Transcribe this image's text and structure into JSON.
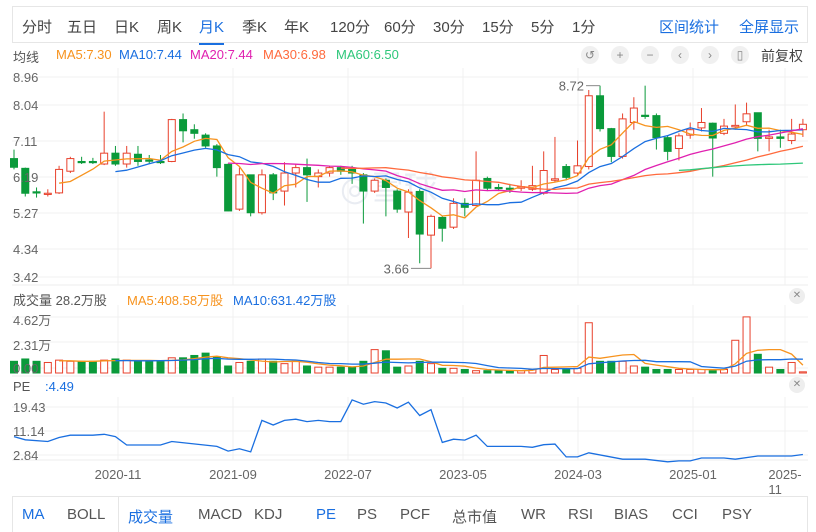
{
  "tabs": [
    {
      "label": "分时"
    },
    {
      "label": "五日"
    },
    {
      "label": "日K"
    },
    {
      "label": "周K"
    },
    {
      "label": "月K",
      "active": true
    },
    {
      "label": "季K"
    },
    {
      "label": "年K"
    },
    {
      "label": "120分"
    },
    {
      "label": "60分"
    },
    {
      "label": "30分"
    },
    {
      "label": "15分"
    },
    {
      "label": "5分"
    },
    {
      "label": "1分"
    }
  ],
  "right_links": {
    "range_stats": "区间统计",
    "fullscreen": "全屏显示"
  },
  "ma_legend": {
    "title": "均线",
    "ma5": "MA5:7.30",
    "ma10": "MA10:7.44",
    "ma20": "MA20:7.44",
    "ma30": "MA30:6.98",
    "ma60": "MA60:6.50"
  },
  "toolbar": {
    "icons": [
      "undo-icon",
      "zoom-in-icon",
      "zoom-out-icon",
      "scroll-left-icon",
      "scroll-right-icon",
      "candle-style-icon"
    ],
    "adjust": "前复权"
  },
  "colors": {
    "up": "#e8412c",
    "down": "#0a9a3a",
    "ma5": "#f7931e",
    "ma10": "#1a6fe0",
    "ma20": "#e020b0",
    "ma30": "#ff6a3d",
    "ma60": "#2ec77a",
    "accent": "#1a6fe0"
  },
  "price_axis": [
    "8.96",
    "8.04",
    "7.11",
    "6.19",
    "5.27",
    "4.34",
    "3.42"
  ],
  "annotations": {
    "high": "8.72",
    "low": "3.66"
  },
  "volume": {
    "title": "成交量 28.2万股",
    "ma5": "MA5:408.58万股",
    "ma10": "MA10:631.42万股",
    "axis": [
      "4.62万",
      "2.31万",
      "0.00"
    ]
  },
  "pe": {
    "title": "PE",
    "value": ":4.49",
    "axis": [
      "19.43",
      "11.14",
      "2.84"
    ]
  },
  "x_axis": [
    "2020-11",
    "2021-09",
    "2022-07",
    "2023-05",
    "2024-03",
    "2025-01",
    "2025-11"
  ],
  "indicators": [
    {
      "label": "MA",
      "on": true
    },
    {
      "label": "BOLL"
    },
    {
      "label": "成交量",
      "on": true
    },
    {
      "label": "MACD"
    },
    {
      "label": "KDJ"
    },
    {
      "label": "PE",
      "on": true
    },
    {
      "label": "PS"
    },
    {
      "label": "PCF"
    },
    {
      "label": "总市值"
    },
    {
      "label": "WR"
    },
    {
      "label": "RSI"
    },
    {
      "label": "BIAS"
    },
    {
      "label": "CCI"
    },
    {
      "label": "PSY"
    }
  ],
  "chart_data": {
    "type": "candlestick",
    "price_range": [
      3.42,
      8.96
    ],
    "ohlc": [
      [
        6.7,
        6.46,
        6.95,
        6.4
      ],
      [
        6.43,
        5.74,
        6.45,
        5.65
      ],
      [
        5.78,
        5.75,
        5.9,
        5.62
      ],
      [
        5.72,
        5.74,
        5.85,
        5.65
      ],
      [
        5.75,
        6.4,
        6.5,
        5.72
      ],
      [
        6.35,
        6.7,
        6.75,
        6.3
      ],
      [
        6.62,
        6.6,
        6.75,
        6.55
      ],
      [
        6.62,
        6.6,
        6.72,
        6.55
      ],
      [
        6.55,
        6.85,
        8.0,
        6.52
      ],
      [
        6.85,
        6.55,
        7.05,
        6.5
      ],
      [
        6.55,
        6.85,
        7.05,
        6.45
      ],
      [
        6.82,
        6.62,
        7.05,
        6.5
      ],
      [
        6.66,
        6.64,
        6.8,
        6.55
      ],
      [
        6.62,
        6.6,
        6.8,
        6.55
      ],
      [
        6.62,
        7.78,
        7.8,
        6.6
      ],
      [
        7.78,
        7.47,
        7.95,
        7.15
      ],
      [
        7.5,
        7.4,
        7.65,
        7.25
      ],
      [
        7.35,
        7.05,
        7.4,
        7.0
      ],
      [
        7.05,
        6.45,
        7.1,
        6.2
      ],
      [
        6.54,
        5.25,
        6.56,
        5.24
      ],
      [
        5.3,
        6.25,
        6.45,
        5.25
      ],
      [
        6.25,
        5.2,
        6.25,
        5.1
      ],
      [
        5.2,
        6.25,
        6.4,
        5.15
      ],
      [
        6.25,
        5.75,
        6.3,
        5.55
      ],
      [
        5.8,
        6.3,
        6.6,
        5.4
      ],
      [
        6.3,
        6.45,
        6.55,
        5.9
      ],
      [
        6.45,
        6.25,
        6.7,
        5.5
      ],
      [
        6.2,
        6.3,
        6.4,
        5.9
      ],
      [
        6.3,
        6.45,
        6.5,
        6.2
      ],
      [
        6.45,
        6.35,
        6.5,
        6.25
      ],
      [
        6.4,
        6.3,
        6.5,
        6.0
      ],
      [
        6.25,
        5.8,
        6.3,
        4.9
      ],
      [
        5.8,
        6.1,
        6.15,
        5.75
      ],
      [
        6.1,
        5.9,
        6.15,
        5.1
      ],
      [
        5.8,
        5.3,
        5.85,
        5.2
      ],
      [
        5.22,
        5.77,
        5.85,
        4.5
      ],
      [
        5.79,
        4.61,
        5.85,
        3.8
      ],
      [
        4.58,
        5.1,
        5.15,
        3.66
      ],
      [
        5.07,
        4.77,
        5.1,
        4.4
      ],
      [
        4.8,
        5.46,
        5.6,
        4.75
      ],
      [
        5.46,
        5.35,
        5.6,
        5.1
      ],
      [
        5.4,
        6.1,
        6.9,
        5.4
      ],
      [
        6.15,
        5.88,
        6.2,
        5.8
      ],
      [
        5.9,
        5.88,
        6.0,
        5.8
      ],
      [
        5.88,
        5.86,
        6.0,
        5.75
      ],
      [
        5.88,
        5.92,
        6.1,
        5.8
      ],
      [
        5.85,
        5.95,
        6.5,
        5.8
      ],
      [
        5.74,
        6.37,
        6.9,
        5.7
      ],
      [
        6.1,
        6.14,
        7.3,
        6.05
      ],
      [
        6.48,
        6.18,
        6.55,
        6.1
      ],
      [
        6.3,
        6.5,
        7.2,
        6.25
      ],
      [
        6.48,
        8.44,
        8.6,
        6.4
      ],
      [
        8.44,
        7.53,
        8.72,
        7.45
      ],
      [
        7.53,
        6.76,
        7.55,
        6.6
      ],
      [
        6.76,
        7.8,
        7.95,
        6.7
      ],
      [
        7.7,
        8.1,
        8.4,
        7.5
      ],
      [
        7.9,
        7.88,
        8.72,
        7.8
      ],
      [
        7.89,
        7.28,
        7.95,
        6.95
      ],
      [
        7.28,
        6.9,
        7.35,
        6.65
      ],
      [
        6.98,
        7.33,
        7.4,
        6.65
      ],
      [
        7.35,
        7.5,
        7.7,
        7.25
      ],
      [
        7.55,
        7.7,
        8.1,
        7.45
      ],
      [
        7.68,
        7.27,
        7.7,
        6.2
      ],
      [
        7.4,
        7.6,
        7.8,
        7.35
      ],
      [
        7.58,
        7.62,
        8.2,
        7.5
      ],
      [
        7.72,
        7.94,
        8.25,
        7.6
      ],
      [
        7.97,
        7.26,
        7.97,
        6.9
      ],
      [
        7.26,
        7.3,
        7.5,
        6.9
      ],
      [
        7.3,
        7.26,
        7.5,
        7.0
      ],
      [
        7.2,
        7.38,
        7.8,
        7.1
      ],
      [
        7.5,
        7.65,
        7.8,
        7.3
      ]
    ],
    "volume_wan": [
      1.0,
      1.2,
      1.0,
      0.9,
      1.1,
      1.0,
      1.0,
      1.0,
      1.1,
      1.2,
      1.1,
      1.0,
      1.0,
      1.0,
      1.3,
      1.3,
      1.5,
      1.7,
      1.4,
      0.6,
      0.9,
      1.0,
      1.2,
      1.0,
      0.8,
      1.0,
      0.6,
      0.5,
      0.5,
      0.5,
      0.5,
      1.0,
      2.0,
      1.9,
      0.5,
      0.6,
      1.0,
      0.8,
      0.4,
      0.4,
      0.3,
      0.2,
      0.2,
      0.2,
      0.2,
      0.2,
      0.3,
      1.5,
      0.3,
      0.3,
      0.4,
      4.3,
      1.0,
      1.0,
      1.0,
      0.6,
      0.5,
      0.3,
      0.3,
      0.3,
      0.3,
      0.3,
      0.2,
      0.3,
      2.8,
      4.8,
      1.6,
      0.5,
      0.3,
      0.9,
      0.1
    ],
    "pe_points": [
      [
        0,
        9.2
      ],
      [
        1,
        8.1
      ],
      [
        3,
        7.5
      ],
      [
        4,
        8.9
      ],
      [
        5,
        9.7
      ],
      [
        7,
        9.7
      ],
      [
        8,
        10.0
      ],
      [
        9,
        9.2
      ],
      [
        10,
        6.3
      ],
      [
        13,
        6.3
      ],
      [
        14,
        7.5
      ],
      [
        18,
        5.8
      ],
      [
        19,
        4.2
      ],
      [
        20,
        5.0
      ],
      [
        21,
        3.9
      ],
      [
        22,
        14.8
      ],
      [
        23,
        13.2
      ],
      [
        24,
        14.8
      ],
      [
        25,
        15.2
      ],
      [
        26,
        14.4
      ],
      [
        27,
        14.8
      ],
      [
        28,
        14.4
      ],
      [
        29,
        14.4
      ],
      [
        30,
        21.9
      ],
      [
        31,
        20.4
      ],
      [
        32,
        21.3
      ],
      [
        33,
        20.8
      ],
      [
        34,
        19.1
      ],
      [
        35,
        21.1
      ],
      [
        36,
        16.5
      ],
      [
        37,
        18.5
      ],
      [
        38,
        7.2
      ],
      [
        39,
        8.3
      ],
      [
        40,
        8.0
      ],
      [
        41,
        9.7
      ],
      [
        42,
        5.8
      ],
      [
        45,
        5.8
      ],
      [
        46,
        5.5
      ],
      [
        47,
        6.4
      ],
      [
        48,
        6.6
      ],
      [
        49,
        2.2
      ],
      [
        50,
        2.2
      ],
      [
        51,
        3.6
      ],
      [
        54,
        1.4
      ],
      [
        56,
        1.4
      ],
      [
        58,
        0.5
      ],
      [
        59,
        0.8
      ],
      [
        60,
        0.8
      ],
      [
        61,
        1.8
      ],
      [
        63,
        1.8
      ],
      [
        64,
        1.4
      ],
      [
        66,
        2.5
      ],
      [
        69,
        2.5
      ],
      [
        70,
        3.0
      ]
    ]
  }
}
